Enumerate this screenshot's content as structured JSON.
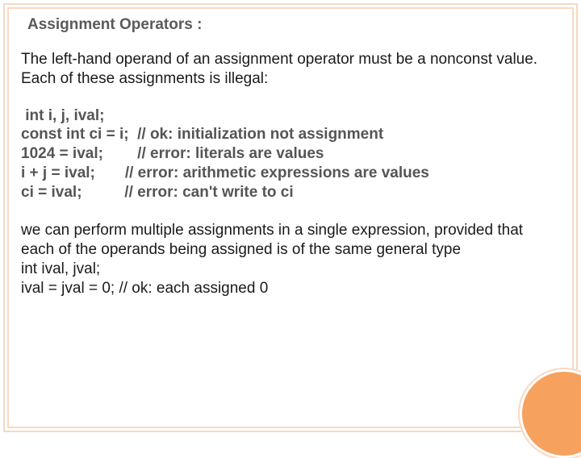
{
  "heading": "Assignment Operators :",
  "intro": "The left-hand operand of an assignment operator must be a nonconst value. Each of these assignments is illegal:",
  "code": " int i, j, ival;\nconst int ci = i;  // ok: initialization not assignment\n1024 = ival;        // error: literals are values\ni + j = ival;       // error: arithmetic expressions are values\nci = ival;          // error: can't write to ci",
  "outro": "we can perform multiple assignments in a single expression, provided that each of the operands being assigned is of the same general type\nint ival, jval;\n     ival = jval = 0; // ok: each assigned 0"
}
